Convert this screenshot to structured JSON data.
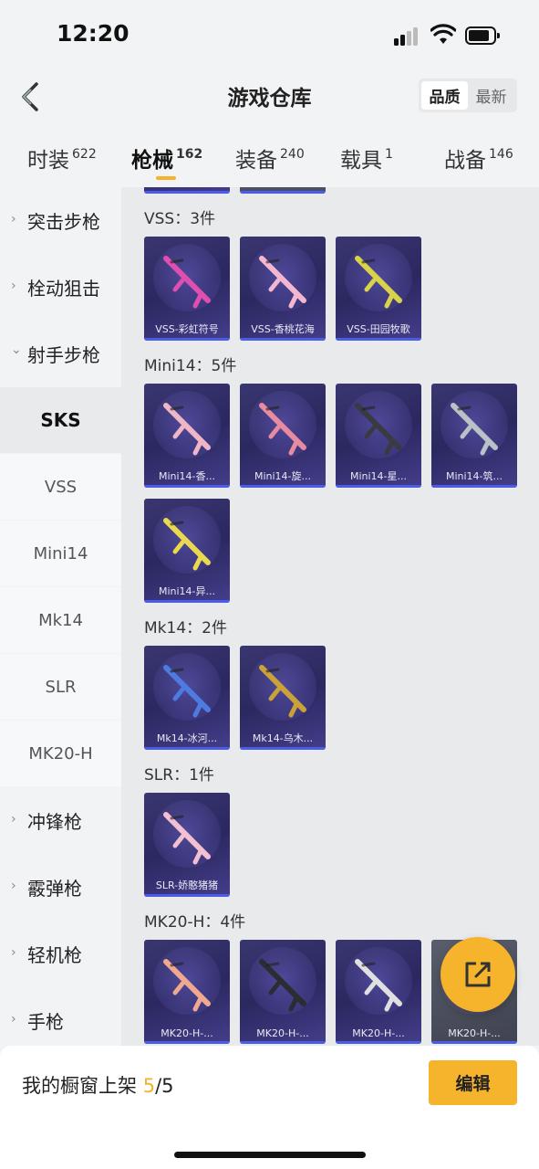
{
  "status": {
    "time": "12:20"
  },
  "header": {
    "title": "游戏仓库",
    "sort_quality": "品质",
    "sort_latest": "最新"
  },
  "tabs": [
    {
      "label": "时装",
      "count": "622"
    },
    {
      "label": "枪械",
      "count": "162"
    },
    {
      "label": "装备",
      "count": "240"
    },
    {
      "label": "载具",
      "count": "1"
    },
    {
      "label": "战备",
      "count": "146"
    }
  ],
  "sidebar": {
    "categories": [
      {
        "label": "突击步枪",
        "chevron": "›"
      },
      {
        "label": "栓动狙击",
        "chevron": "›"
      },
      {
        "label": "射手步枪",
        "chevron": "⌄"
      },
      {
        "label": "冲锋枪",
        "chevron": "›"
      },
      {
        "label": "霰弹枪",
        "chevron": "›"
      },
      {
        "label": "轻机枪",
        "chevron": "›"
      },
      {
        "label": "手枪",
        "chevron": "›"
      }
    ],
    "subs": [
      "SKS",
      "VSS",
      "Mini14",
      "Mk14",
      "SLR",
      "MK20-H"
    ]
  },
  "sections": [
    {
      "title": "VSS：3件",
      "items": [
        "VSS-彩虹符号",
        "VSS-香桃花海",
        "VSS-田园牧歌"
      ]
    },
    {
      "title": "Mini14：5件",
      "items": [
        "Mini14-香...",
        "Mini14-旋...",
        "Mini14-星...",
        "Mini14-筑...",
        "Mini14-异..."
      ]
    },
    {
      "title": "Mk14：2件",
      "items": [
        "Mk14-冰河...",
        "Mk14-乌木..."
      ]
    },
    {
      "title": "SLR：1件",
      "items": [
        "SLR-娇憨猪猪"
      ]
    },
    {
      "title": "MK20-H：4件",
      "items": [
        "MK20-H-...",
        "MK20-H-...",
        "MK20-H-...",
        "MK20-H-..."
      ]
    }
  ],
  "gun_colors": {
    "vss": [
      "#e04fb0",
      "#f3b8cf",
      "#d9d34a"
    ],
    "mini14": [
      "#f0b6c6",
      "#e88aa0",
      "#3a3a44",
      "#b9c3c6",
      "#e9d94e"
    ],
    "mk14": [
      "#4e7be0",
      "#c9a23a"
    ],
    "slr": [
      "#f2c0d0"
    ],
    "mk20": [
      "#f0a890",
      "#2c2c33",
      "#e0e0e0",
      "#888888"
    ]
  },
  "bottom": {
    "showcase_label": "我的橱窗上架",
    "showcase_count": "5",
    "showcase_total": "/5",
    "edit_label": "编辑"
  }
}
